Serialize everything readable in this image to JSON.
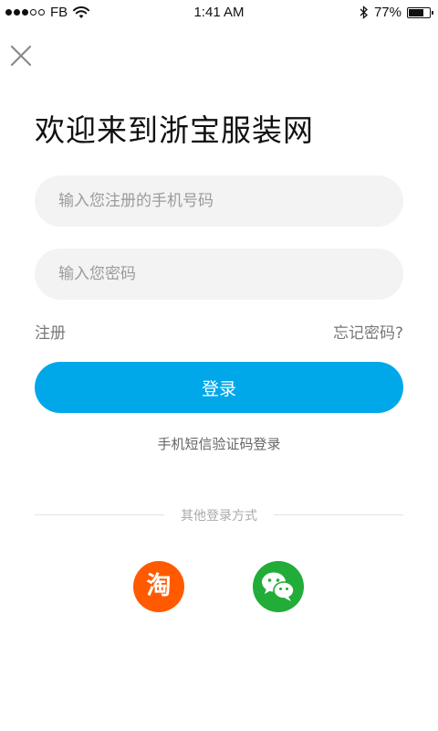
{
  "status_bar": {
    "carrier": "FB",
    "time": "1:41 AM",
    "battery_percent": "77%",
    "battery_level": 0.77
  },
  "page": {
    "title": "欢迎来到浙宝服装网"
  },
  "form": {
    "phone_placeholder": "输入您注册的手机号码",
    "password_placeholder": "输入您密码",
    "register_label": "注册",
    "forgot_label": "忘记密码?",
    "login_label": "登录",
    "sms_login_label": "手机短信验证码登录"
  },
  "other_login": {
    "label": "其他登录方式",
    "taobao_glyph": "淘",
    "icons": [
      "taobao-icon",
      "wechat-icon"
    ]
  },
  "colors": {
    "primary": "#00a8ea",
    "taobao": "#ff5a00",
    "wechat": "#22ac38"
  }
}
